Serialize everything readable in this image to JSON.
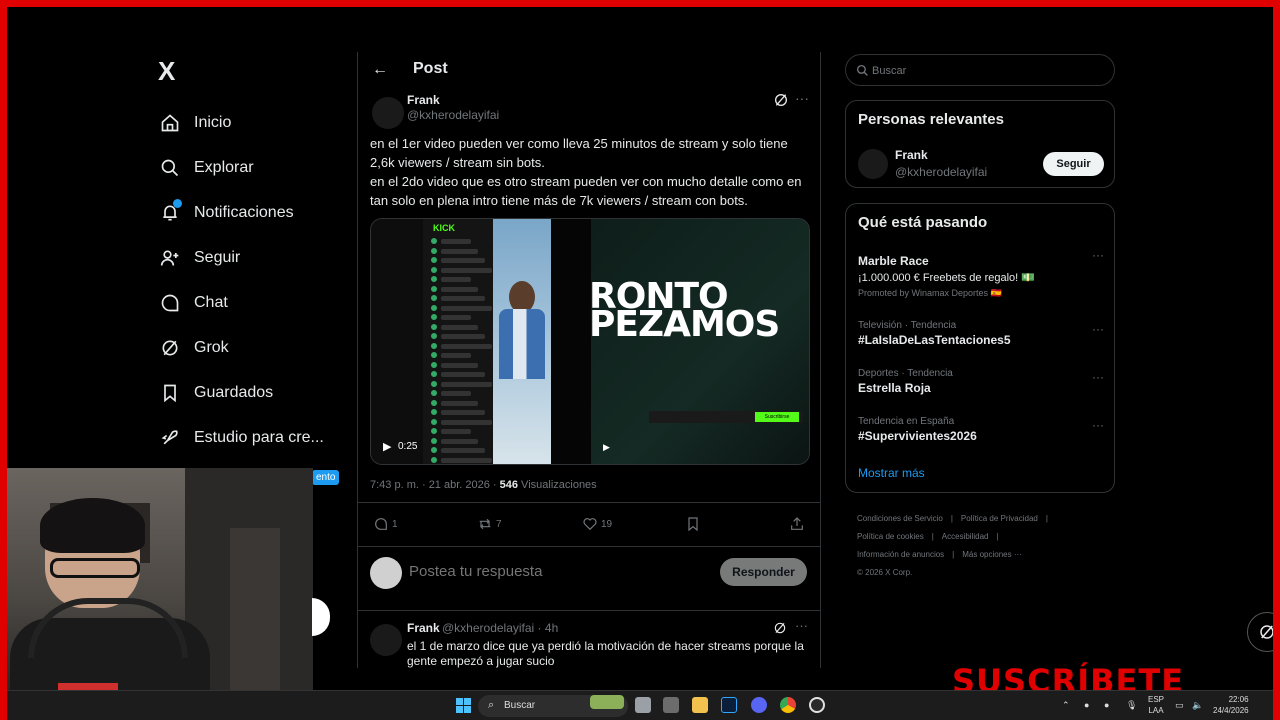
{
  "app": {
    "logo": "X"
  },
  "sidebar": {
    "items": [
      {
        "label": "Inicio",
        "icon": "home-icon"
      },
      {
        "label": "Explorar",
        "icon": "search-icon"
      },
      {
        "label": "Notificaciones",
        "icon": "bell-icon"
      },
      {
        "label": "Seguir",
        "icon": "person-add-icon"
      },
      {
        "label": "Chat",
        "icon": "chat-icon"
      },
      {
        "label": "Grok",
        "icon": "grok-icon"
      },
      {
        "label": "Guardados",
        "icon": "bookmark-icon"
      },
      {
        "label": "Estudio para cre...",
        "icon": "rocket-icon"
      }
    ],
    "badge_partial": "ento"
  },
  "post": {
    "header_title": "Post",
    "author_name": "Frank",
    "author_handle": "@kxherodelayifai",
    "text": "en el 1er video pueden ver como lleva 25 minutos de stream y solo tiene 2,6k viewers / stream sin bots.\nen el 2do video que es otro stream pueden ver con mucho detalle como en  tan solo en plena intro tiene más de 7k viewers / stream con bots.",
    "media": {
      "kick_logo": "KICK",
      "overlay_line1": "RONTO",
      "overlay_line2": "PEZAMOS",
      "subscribe_overlay": "Suscribirse",
      "duration": "0:25"
    },
    "timestamp": "7:43 p. m. · 21 abr. 2026 · ",
    "views_count": "546",
    "views_label": " Visualizaciones",
    "actions": {
      "replies": "1",
      "reposts": "7",
      "likes": "19"
    },
    "reply_placeholder": "Postea tu respuesta",
    "reply_button": "Responder"
  },
  "comment": {
    "name": "Frank",
    "handle": "@kxherodelayifai · 4h",
    "text": "el 1 de marzo dice  que ya perdió la motivación de hacer streams porque la gente empezó a jugar sucio"
  },
  "right": {
    "search_placeholder": "Buscar",
    "relevant_title": "Personas relevantes",
    "relevant_name": "Frank",
    "relevant_handle": "@kxherodelayifai",
    "follow_label": "Seguir",
    "trends_title": "Qué está pasando",
    "trends": [
      {
        "context": "",
        "title": "Marble Race",
        "sub": "¡1.000.000 € Freebets de regalo! 💵",
        "promo": "Promoted by Winamax Deportes 🇪🇸"
      },
      {
        "context": "Televisión · Tendencia",
        "title": "#LaIslaDeLasTentaciones5"
      },
      {
        "context": "Deportes · Tendencia",
        "title": "Estrella Roja"
      },
      {
        "context": "Tendencia en España",
        "title": "#Supervivientes2026"
      }
    ],
    "show_more": "Mostrar más",
    "footer": [
      "Condiciones de Servicio",
      "|",
      "Política de Privacidad",
      "|",
      "Política de cookies",
      "|",
      "Accesibilidad",
      "|",
      "Información de anuncios",
      "|",
      "Más opciones ···",
      "© 2026 X Corp."
    ]
  },
  "overlay": {
    "subscribe_text": "SUSCRÍBETE"
  },
  "taskbar": {
    "search_label": "Buscar",
    "lang_line1": "ESP",
    "lang_line2": "LAA",
    "time": "22:06",
    "date": "24/4/2026"
  },
  "colors": {
    "accent": "#1d9bf0",
    "frame": "#e00000",
    "kick_green": "#53fc18"
  }
}
